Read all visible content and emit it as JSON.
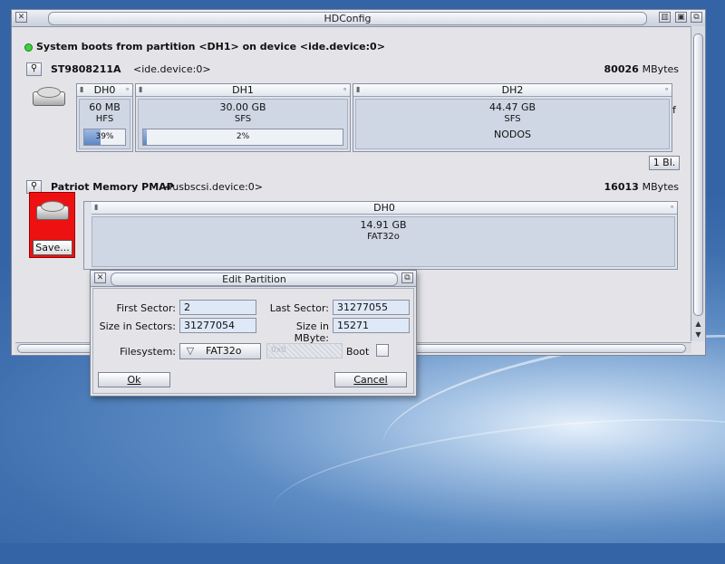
{
  "window": {
    "title": "HDConfig",
    "boot_status": "System boots from partition <DH1> on device <ide.device:0>"
  },
  "disk1": {
    "name": "ST9808211A",
    "device": "<ide.device:0>",
    "size_num": "80026",
    "size_unit": "MBytes",
    "partitions": [
      {
        "name": "DH0",
        "size": "60 MB",
        "fs": "HFS",
        "usage": "39%",
        "usage_pct": 39
      },
      {
        "name": "DH1",
        "size": "30.00 GB",
        "fs": "SFS",
        "usage": "2%",
        "usage_pct": 2
      },
      {
        "name": "DH2",
        "size": "44.47 GB",
        "fs": "SFS",
        "status": "NODOS"
      }
    ],
    "trailing_mark": "f",
    "block_button": "1 Bl."
  },
  "disk2": {
    "name": "Patriot Memory  PMAP",
    "device": "<usbscsi.device:0>",
    "size_num": "16013",
    "size_unit": "MBytes",
    "save_button": "Save...",
    "partitions": [
      {
        "name": "DH0",
        "size": "14.91 GB",
        "fs": "FAT32o"
      }
    ]
  },
  "dialog": {
    "title": "Edit Partition",
    "first_sector_label": "First Sector:",
    "first_sector": "2",
    "last_sector_label": "Last Sector:",
    "last_sector": "31277055",
    "size_sectors_label": "Size in Sectors:",
    "size_sectors": "31277054",
    "size_mbyte_label": "Size in MByte:",
    "size_mbyte": "15271",
    "filesystem_label": "Filesystem:",
    "filesystem": "FAT32o",
    "hex_placeholder": "0x0",
    "boot_label": "Boot",
    "ok": "Ok",
    "cancel": "Cancel"
  },
  "colors": {
    "desktop": "#3f6fae",
    "selected_disk": "#ee1111",
    "window_bg": "#e4e4e8"
  }
}
